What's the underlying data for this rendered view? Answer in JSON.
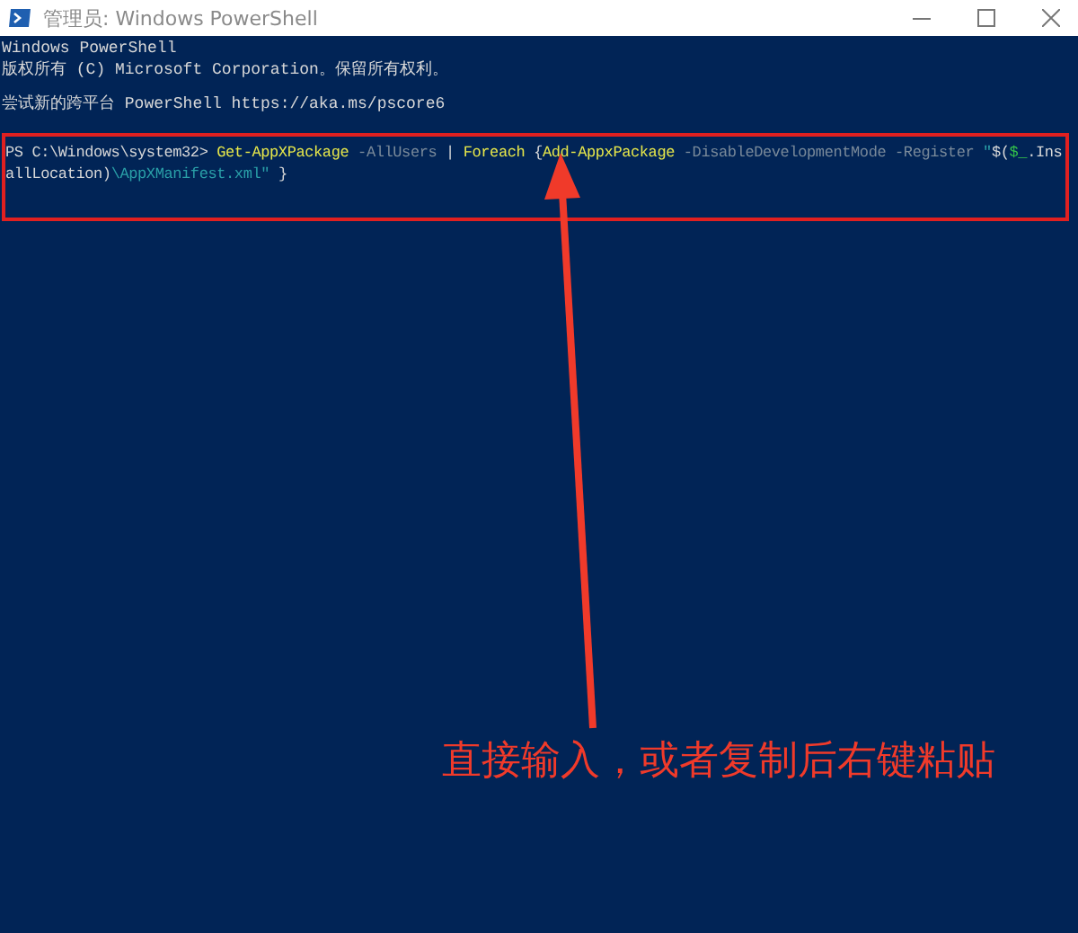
{
  "window": {
    "title": "管理员: Windows PowerShell"
  },
  "console": {
    "lines": [
      {
        "segments": [
          {
            "text": "Windows PowerShell",
            "kind": "plain"
          }
        ]
      },
      {
        "segments": [
          {
            "text": "版权所有 (C) Microsoft Corporation。保留所有权利。",
            "kind": "plain"
          }
        ]
      },
      {
        "kind": "blank"
      },
      {
        "segments": [
          {
            "text": "尝试新的跨平台 PowerShell https://aka.ms/pscore6",
            "kind": "plain"
          }
        ]
      },
      {
        "kind": "blank"
      }
    ],
    "highlighted_lines": [
      {
        "segments": [
          {
            "text": "PS C:\\Windows\\system32> ",
            "kind": "plain"
          },
          {
            "text": "Get-AppXPackage",
            "kind": "command"
          },
          {
            "text": " -AllUsers",
            "kind": "parameter"
          },
          {
            "text": " | ",
            "kind": "plain"
          },
          {
            "text": "Foreach",
            "kind": "command"
          },
          {
            "text": " {",
            "kind": "plain"
          },
          {
            "text": "Add-AppxPackage",
            "kind": "command"
          },
          {
            "text": " -DisableDevelopmentMode -Register ",
            "kind": "parameter"
          },
          {
            "text": "\"",
            "kind": "string"
          },
          {
            "text": "$(",
            "kind": "plain"
          },
          {
            "text": "$_",
            "kind": "variable"
          },
          {
            "text": ".Ins",
            "kind": "plain"
          }
        ]
      },
      {
        "segments": [
          {
            "text": "allLocation)",
            "kind": "plain"
          },
          {
            "text": "\\AppXManifest.xml",
            "kind": "string"
          },
          {
            "text": "\"",
            "kind": "string"
          },
          {
            "text": " }",
            "kind": "plain"
          }
        ]
      }
    ]
  },
  "annotation": {
    "text": "直接输入，或者复制后右键粘贴"
  }
}
